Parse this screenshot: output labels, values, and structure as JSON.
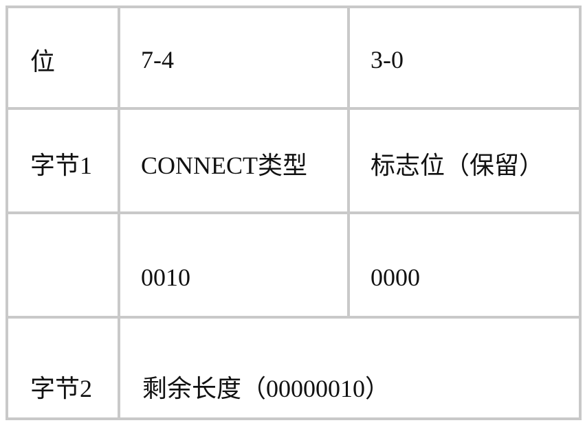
{
  "table": {
    "rows": [
      {
        "cells": [
          "位",
          "7-4",
          "3-0"
        ]
      },
      {
        "cells": [
          "字节1",
          "CONNECT类型",
          "标志位（保留）"
        ]
      },
      {
        "cells": [
          "",
          "0010",
          "0000"
        ]
      },
      {
        "cells": [
          "字节2",
          "剩余长度（00000010）"
        ]
      }
    ]
  }
}
